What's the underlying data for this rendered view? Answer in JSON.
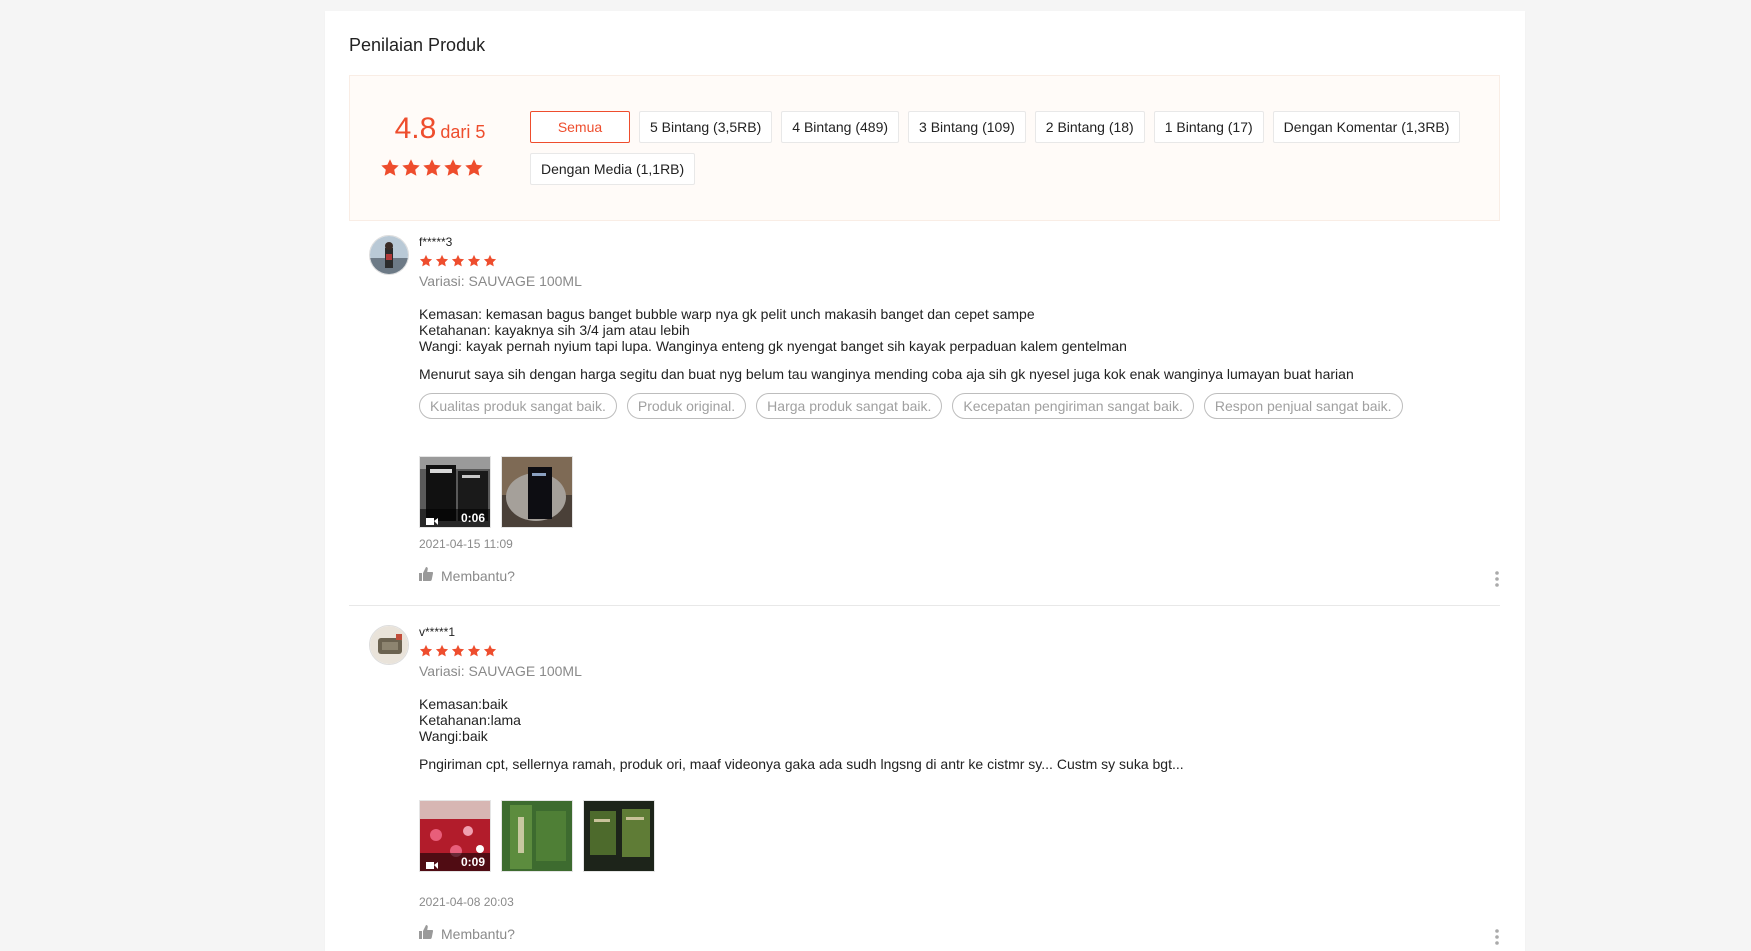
{
  "section_title": "Penilaian Produk",
  "summary": {
    "score": "4.8",
    "out_of": "dari 5",
    "star_count": 5
  },
  "filters": [
    {
      "label": "Semua",
      "active": true
    },
    {
      "label": "5 Bintang (3,5RB)",
      "active": false
    },
    {
      "label": "4 Bintang (489)",
      "active": false
    },
    {
      "label": "3 Bintang (109)",
      "active": false
    },
    {
      "label": "2 Bintang (18)",
      "active": false
    },
    {
      "label": "1 Bintang (17)",
      "active": false
    },
    {
      "label": "Dengan Komentar (1,3RB)",
      "active": false
    },
    {
      "label": "Dengan Media (1,1RB)",
      "active": false
    }
  ],
  "colors": {
    "accent": "#ee4d2d",
    "summary_bg": "#fffbf8",
    "muted": "#8a8a8a"
  },
  "reviews": [
    {
      "username": "f*****3",
      "rating": 5,
      "variant": "Variasi: SAUVAGE 100ML",
      "body_lines": [
        "Kemasan: kemasan bagus banget bubble warp nya gk pelit unch makasih banget dan cepet sampe",
        "Ketahanan: kayaknya sih 3/4 jam atau lebih",
        "Wangi: kayak pernah nyium tapi lupa. Wanginya enteng gk nyengat banget sih kayak perpaduan kalem gentelman"
      ],
      "comment": "Menurut saya sih dengan harga segitu dan buat nyg belum tau wanginya mending coba aja sih gk nyesel juga kok enak wanginya lumayan buat harian",
      "tags": [
        "Kualitas produk sangat baik.",
        "Produk original.",
        "Harga produk sangat baik.",
        "Kecepatan pengiriman sangat baik.",
        "Respon penjual sangat baik."
      ],
      "media": [
        {
          "type": "video",
          "duration": "0:06"
        },
        {
          "type": "image"
        }
      ],
      "date": "2021-04-15 11:09",
      "helpful_label": "Membantu?"
    },
    {
      "username": "v*****1",
      "rating": 5,
      "variant": "Variasi: SAUVAGE 100ML",
      "body_lines": [
        "Kemasan:baik",
        "Ketahanan:lama",
        "Wangi:baik"
      ],
      "comment": "Pngiriman cpt, sellernya ramah, produk ori, maaf videonya gaka ada sudh lngsng di antr ke cistmr sy... Custm sy suka bgt...",
      "tags": [],
      "media": [
        {
          "type": "video",
          "duration": "0:09"
        },
        {
          "type": "image"
        },
        {
          "type": "image"
        }
      ],
      "date": "2021-04-08 20:03",
      "helpful_label": "Membantu?"
    }
  ]
}
